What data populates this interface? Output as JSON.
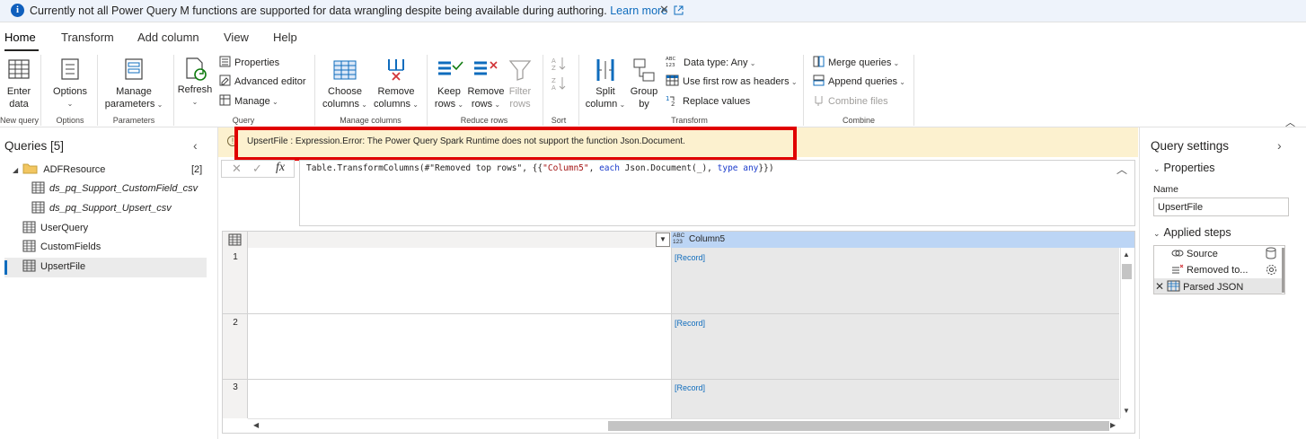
{
  "info_bar": {
    "message": "Currently not all Power Query M functions are supported for data wrangling despite being available during authoring.",
    "link": "Learn more"
  },
  "tabs": [
    {
      "label": "Home",
      "active": true
    },
    {
      "label": "Transform"
    },
    {
      "label": "Add column"
    },
    {
      "label": "View"
    },
    {
      "label": "Help"
    }
  ],
  "ribbon": {
    "enter_data": {
      "line1": "Enter",
      "line2": "data"
    },
    "options": {
      "line1": "Options"
    },
    "manage_parameters": {
      "line1": "Manage",
      "line2": "parameters"
    },
    "refresh": {
      "line1": "Refresh"
    },
    "properties": "Properties",
    "advanced_editor": "Advanced editor",
    "manage": "Manage",
    "choose_columns": {
      "line1": "Choose",
      "line2": "columns"
    },
    "remove_columns": {
      "line1": "Remove",
      "line2": "columns"
    },
    "keep_rows": {
      "line1": "Keep",
      "line2": "rows"
    },
    "remove_rows": {
      "line1": "Remove",
      "line2": "rows"
    },
    "filter_rows": {
      "line1": "Filter",
      "line2": "rows"
    },
    "split_column": {
      "line1": "Split",
      "line2": "column"
    },
    "group_by": {
      "line1": "Group",
      "line2": "by"
    },
    "data_type": "Data type: Any",
    "use_first_row": "Use first row as headers",
    "replace_values": "Replace values",
    "merge_queries": "Merge queries",
    "append_queries": "Append queries",
    "combine_files": "Combine files",
    "groups": {
      "new_query": "New query",
      "options": "Options",
      "parameters": "Parameters",
      "query": "Query",
      "manage_columns": "Manage columns",
      "reduce_rows": "Reduce rows",
      "sort": "Sort",
      "transform": "Transform",
      "combine": "Combine"
    }
  },
  "queries": {
    "title": "Queries [5]",
    "folder": {
      "name": "ADFResource",
      "count": "[2]"
    },
    "children": [
      "ds_pq_Support_CustomField_csv",
      "ds_pq_Support_Upsert_csv"
    ],
    "items": [
      "UserQuery",
      "CustomFields",
      "UpsertFile"
    ]
  },
  "error": {
    "message": "UpsertFile : Expression.Error: The Power Query Spark Runtime does not support the function Json.Document."
  },
  "formula": {
    "fn": "Table.TransformColumns(",
    "arg1": "#\"Removed top rows\"",
    "sep": ", {{",
    "col": "\"Column5\"",
    "sep2": ", ",
    "each": "each",
    "body": " Json.Document(_), ",
    "type": "type",
    "any": " any",
    "end": "}})"
  },
  "grid": {
    "type_badge_top": "ABC",
    "type_badge_bottom": "123",
    "column_name": "Column5",
    "rows": [
      {
        "num": "1",
        "value": "[Record]"
      },
      {
        "num": "2",
        "value": "[Record]"
      },
      {
        "num": "3",
        "value": "[Record]"
      }
    ]
  },
  "query_settings": {
    "title": "Query settings",
    "properties_title": "Properties",
    "name_label": "Name",
    "name_value": "UpsertFile",
    "steps_title": "Applied steps",
    "steps": [
      "Source",
      "Removed to...",
      "Parsed JSON"
    ]
  },
  "colors": {
    "accent": "#0f6cbd",
    "error_bg": "#fcf1cf",
    "highlight_box": "#e00000",
    "column_header": "#bcd5f5"
  }
}
